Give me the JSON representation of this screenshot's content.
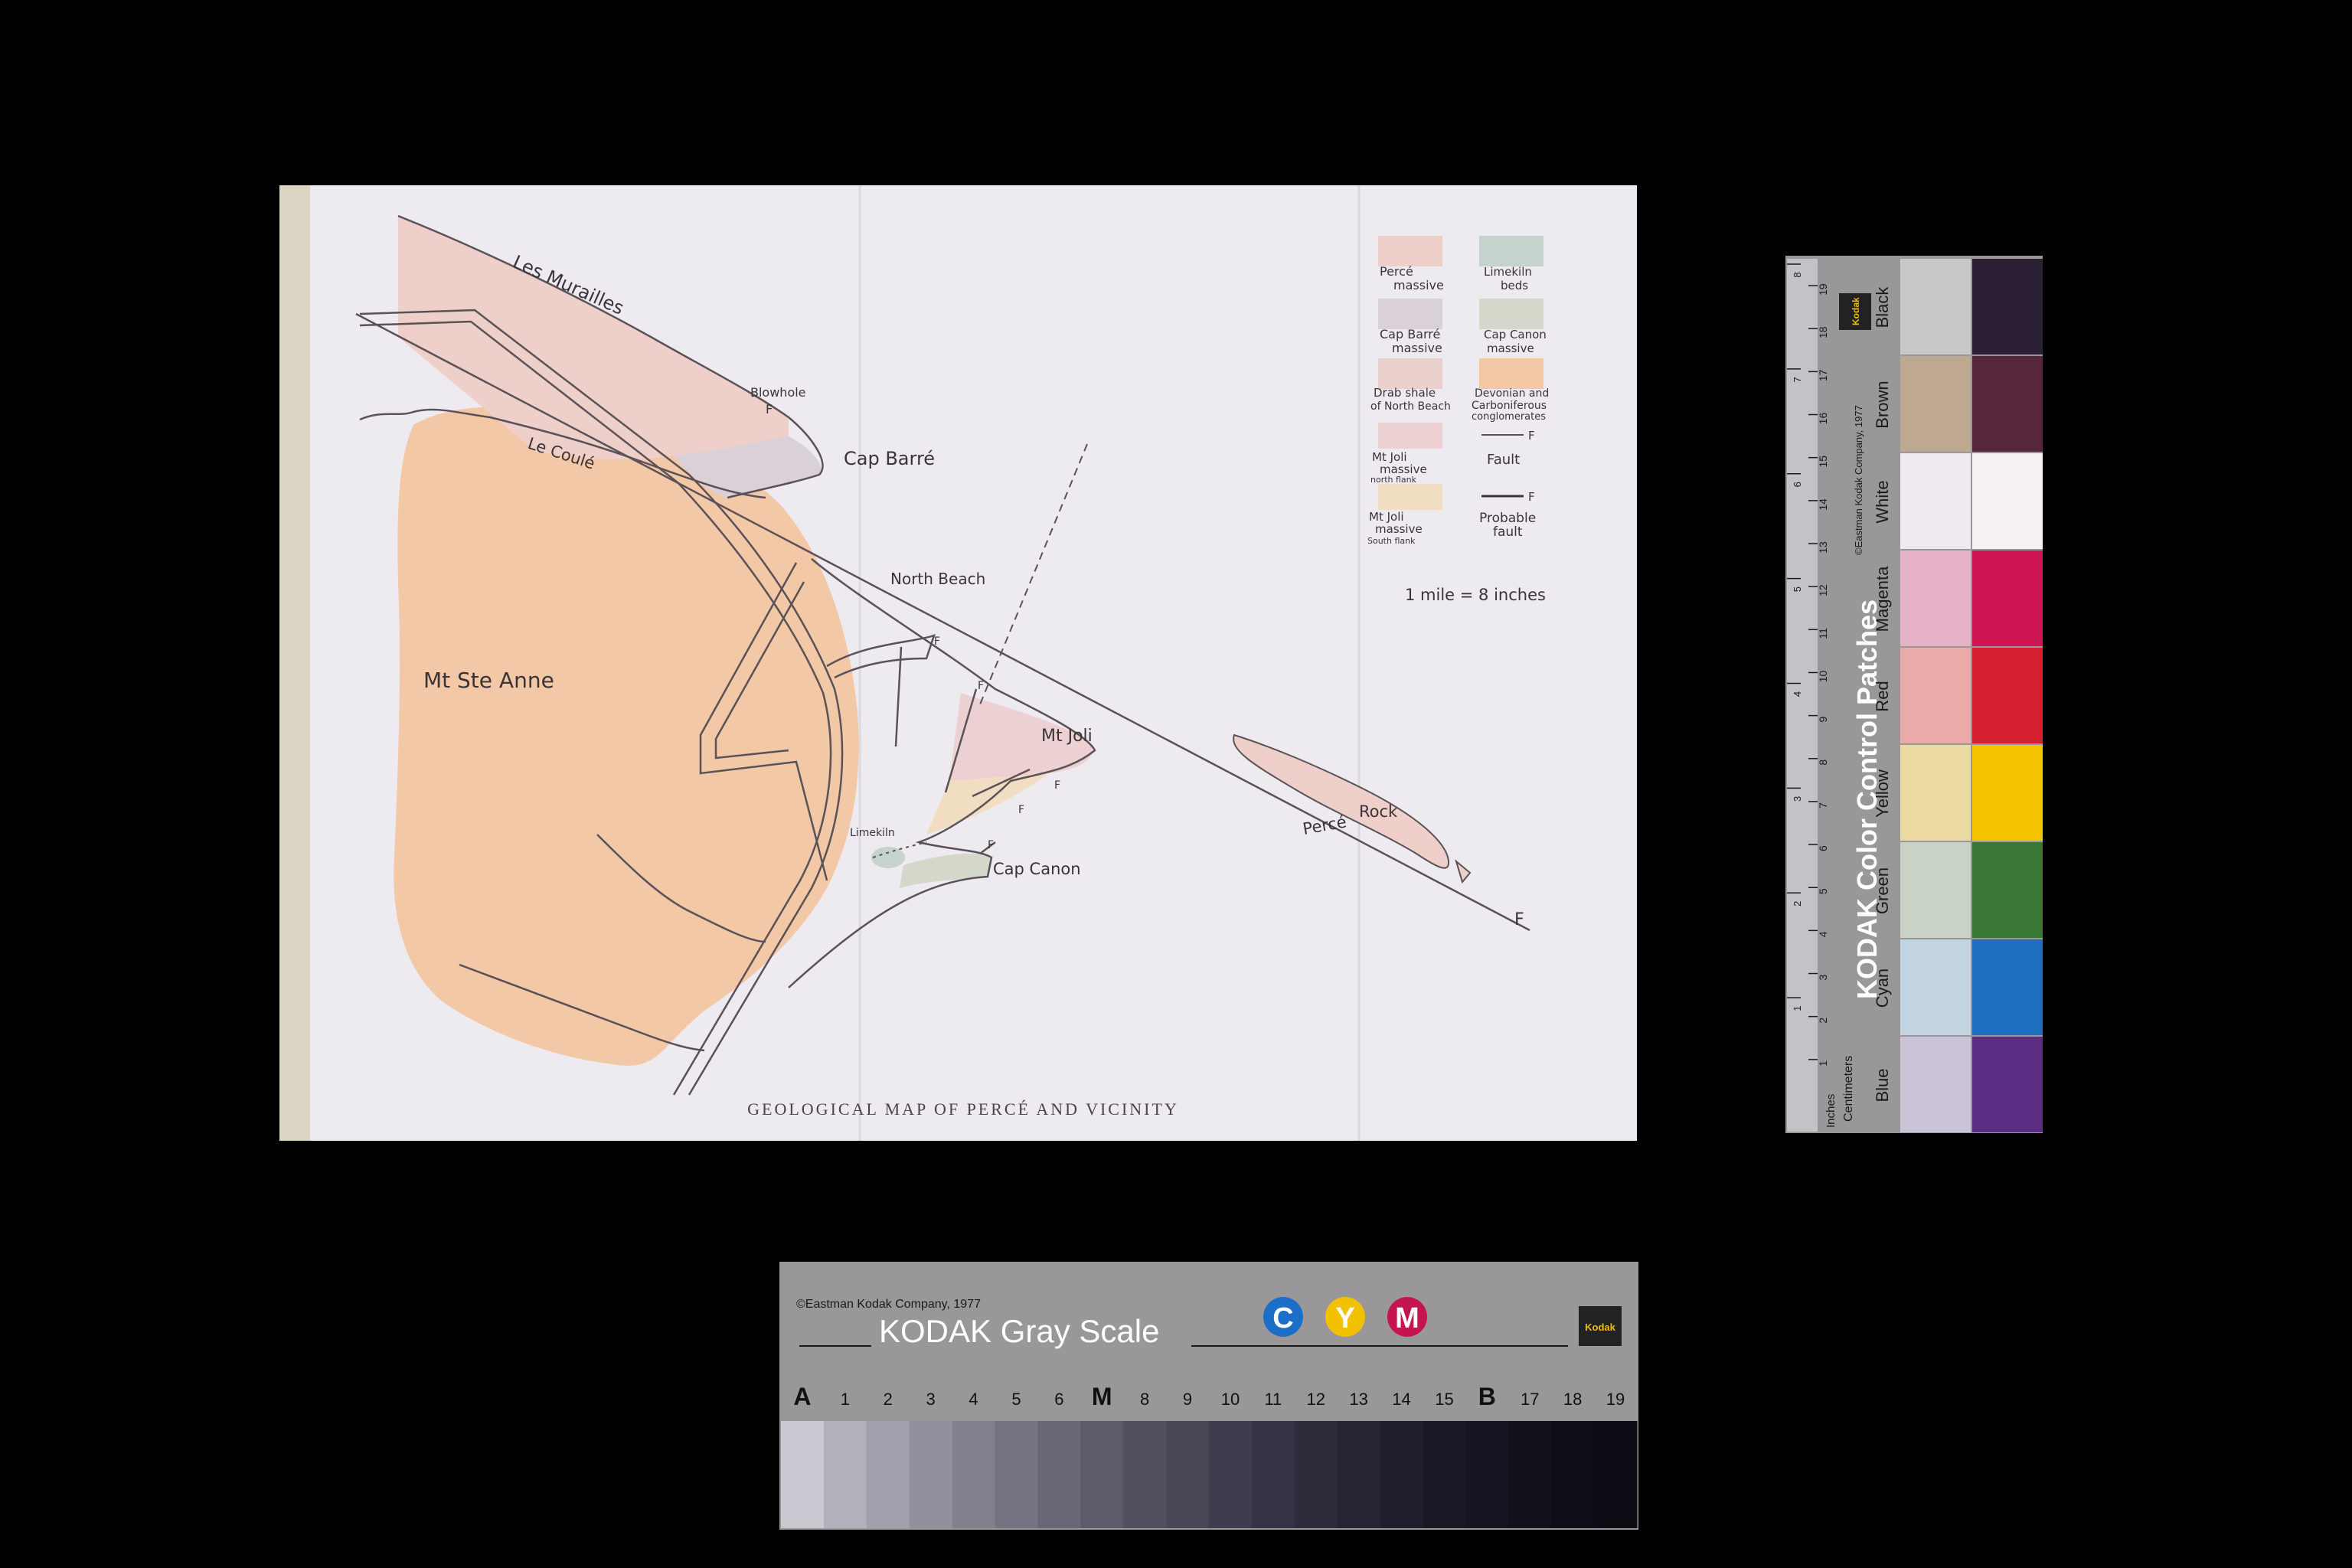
{
  "map": {
    "caption": "GEOLOGICAL MAP OF PERCÉ AND VICINITY",
    "places": {
      "les_murailles": "Les Murailles",
      "le_coule": "Le Coulé",
      "blowhole": "Blowhole",
      "cap_barre": "Cap Barré",
      "north_beach": "North Beach",
      "mt_ste_anne": "Mt Ste Anne",
      "mt_joli": "Mt Joli",
      "limekiln": "Limekiln",
      "cap_canon": "Cap Canon",
      "perce": "Percé",
      "rock": "Rock",
      "fault_f": "F",
      "fault_f_small": "F"
    },
    "legend": [
      {
        "key": "perce",
        "l1": "Percé",
        "l2": "massive",
        "color": "#efcfc9"
      },
      {
        "key": "limekiln",
        "l1": "Limekiln",
        "l2": "beds",
        "color": "#c6d3cd"
      },
      {
        "key": "capbarre",
        "l1": "Cap Barré",
        "l2": "massive",
        "color": "#d9d1d7"
      },
      {
        "key": "capcanon",
        "l1": "Cap Canon",
        "l2": "massive",
        "color": "#d3d8cb"
      },
      {
        "key": "drab",
        "l1": "Drab shale",
        "l2": "of North Beach",
        "color": "#ead1ce"
      },
      {
        "key": "devonian",
        "l1": "Devonian and",
        "l2": "Carboniferous",
        "l3": "conglomerates",
        "color": "#f3c8a6"
      },
      {
        "key": "joli_n",
        "l1": "Mt Joli",
        "l2": "massive",
        "l3": "north flank",
        "color": "#ecd0d2"
      },
      {
        "key": "joli_s",
        "l1": "Mt Joli",
        "l2": "massive",
        "l3": "South flank",
        "color": "#f1ddc1"
      }
    ],
    "legend_fault": "Fault",
    "legend_probable_l1": "Probable",
    "legend_probable_l2": "fault",
    "scale": "1 mile = 8 inches"
  },
  "color_card": {
    "title": "KODAK Color Control Patches",
    "copyright": "©Eastman Kodak Company, 1977",
    "inches_label": "Inches",
    "cm_label": "Centimeters",
    "logo": "Kodak",
    "ruler_inches": [
      "1",
      "2",
      "3",
      "4",
      "5",
      "6",
      "7",
      "8"
    ],
    "ruler_cm": [
      "1",
      "2",
      "3",
      "4",
      "5",
      "6",
      "7",
      "8",
      "9",
      "10",
      "11",
      "12",
      "13",
      "14",
      "15",
      "16",
      "17",
      "18",
      "19"
    ],
    "patches": [
      {
        "name": "Black",
        "light": "#c9c8c9",
        "dark": "#2b1f34"
      },
      {
        "name": "Brown",
        "light": "#bfa892",
        "dark": "#57263a"
      },
      {
        "name": "White",
        "light": "#efeaef",
        "dark": "#f4f0f4"
      },
      {
        "name": "Magenta",
        "light": "#e5b2c8",
        "dark": "#cd1651"
      },
      {
        "name": "Red",
        "light": "#e9aaa9",
        "dark": "#d4202f"
      },
      {
        "name": "Yellow",
        "light": "#ebdba2",
        "dark": "#f4c400"
      },
      {
        "name": "Green",
        "light": "#c8d2c5",
        "dark": "#3a7634"
      },
      {
        "name": "Cyan",
        "light": "#c3d4e2",
        "dark": "#1e6fc0"
      },
      {
        "name": "Blue",
        "light": "#cbc3d8",
        "dark": "#5a2d83"
      }
    ]
  },
  "gray_card": {
    "copyright": "©Eastman Kodak Company, 1977",
    "title": "KODAK Gray Scale",
    "cym": [
      "C",
      "Y",
      "M"
    ],
    "cym_colors": [
      "#1b6fc7",
      "#f2c200",
      "#c5154e"
    ],
    "logo": "Kodak",
    "steps": [
      "A",
      "1",
      "2",
      "3",
      "4",
      "5",
      "6",
      "M",
      "8",
      "9",
      "10",
      "11",
      "12",
      "13",
      "14",
      "15",
      "B",
      "17",
      "18",
      "19"
    ],
    "step_shades": [
      "#ccc9d2",
      "#b3afbb",
      "#a29eab",
      "#938f9c",
      "#84808e",
      "#767282",
      "#6a6676",
      "#5e5a6a",
      "#534f5f",
      "#4a4656",
      "#403c4d",
      "#373344",
      "#2f2b3b",
      "#282434",
      "#211d2d",
      "#1b1826",
      "#171321",
      "#13101c",
      "#100d18",
      "#0d0b14"
    ]
  }
}
